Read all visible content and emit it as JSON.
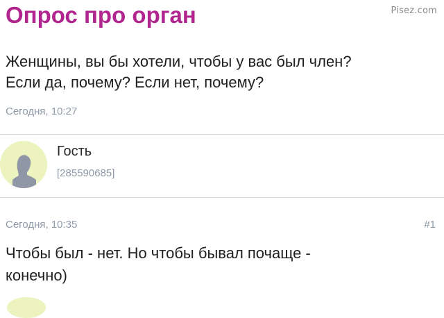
{
  "watermark": "Pisez.com",
  "topic": {
    "title": "Опрос про орган",
    "question_lines": [
      "Женщины, вы бы хотели, чтобы у вас был член?",
      "Если да, почему? Если нет, почему?"
    ],
    "date": "Сегодня, 10:27"
  },
  "reply": {
    "author": {
      "name": "Гость",
      "id": "[285590685]",
      "avatar_icon": "user-silhouette-icon"
    },
    "date": "Сегодня, 10:35",
    "number": "#1",
    "text_lines": [
      "Чтобы был - нет. Но чтобы бывал почаще -",
      "конечно)"
    ]
  },
  "colors": {
    "title": "#b0258e",
    "meta": "#8f9aa8",
    "avatar_bg": "#ecf3bf",
    "avatar_figure": "#8f96a6",
    "divider": "#d7dbe0"
  }
}
